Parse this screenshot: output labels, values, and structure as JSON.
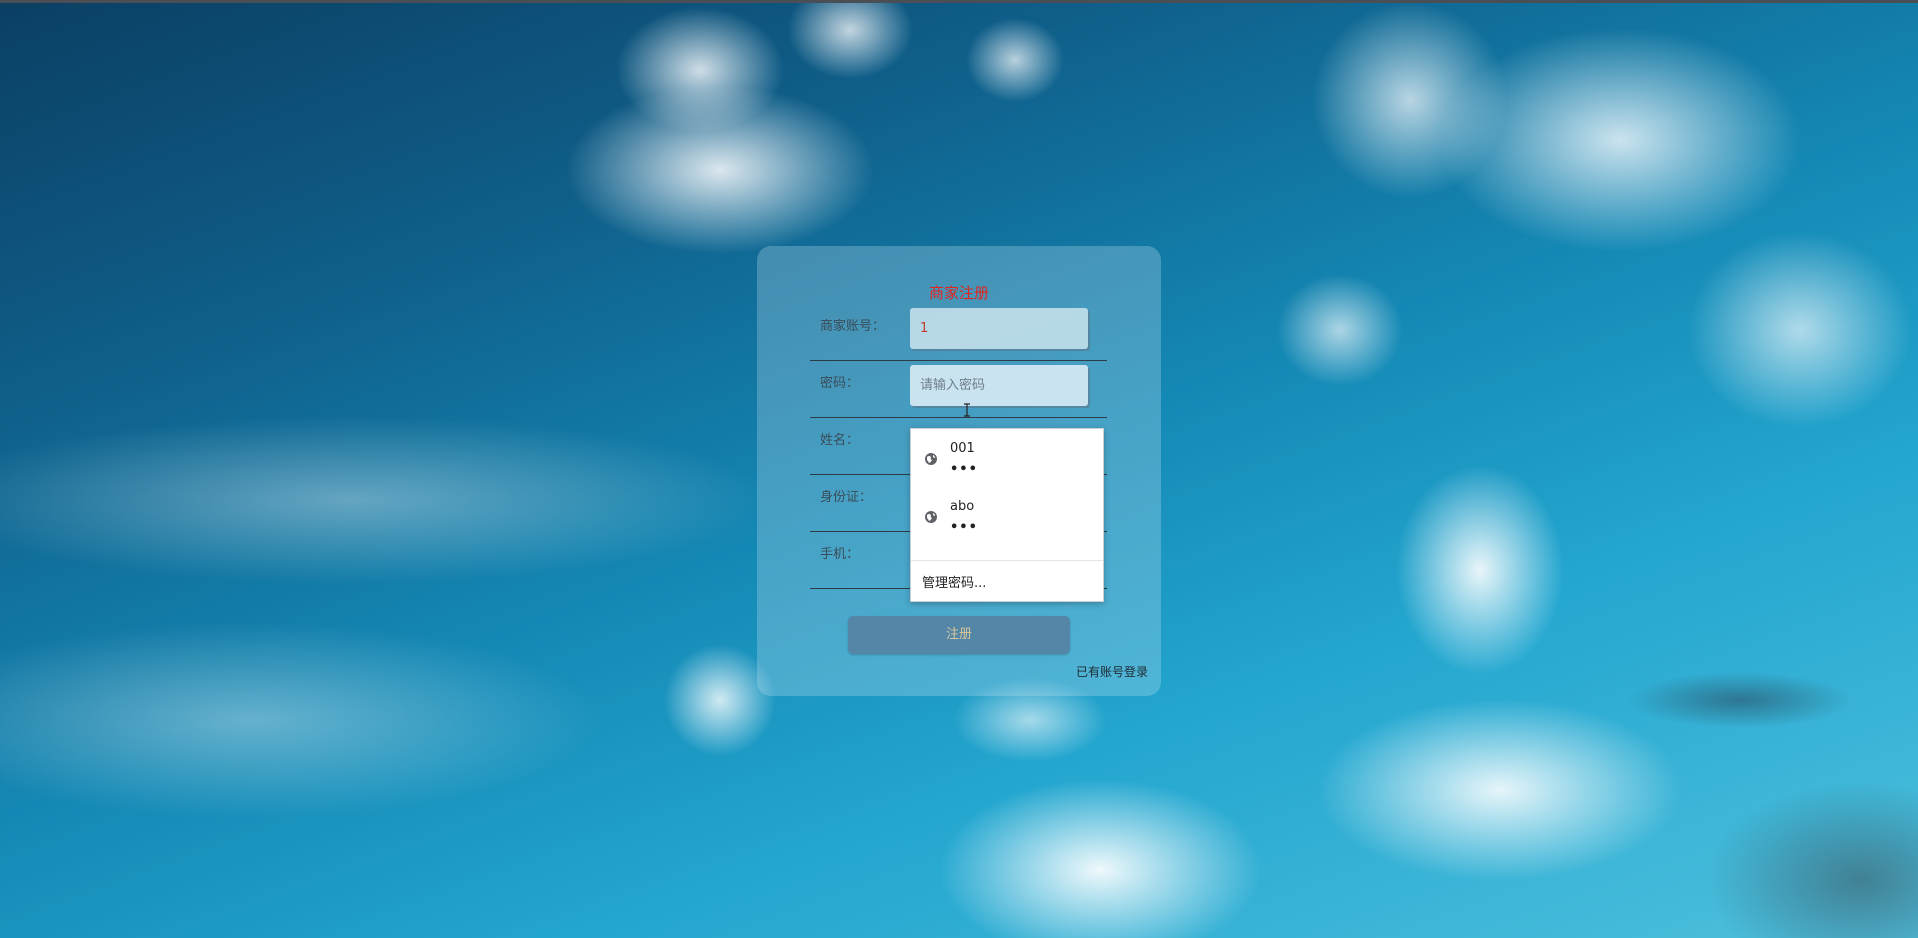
{
  "form": {
    "title": "商家注册",
    "fields": [
      {
        "label": "商家账号：",
        "value": "1",
        "placeholder": ""
      },
      {
        "label": "密码：",
        "value": "",
        "placeholder": "请输入密码"
      },
      {
        "label": "姓名：",
        "value": "",
        "placeholder": ""
      },
      {
        "label": "身份证：",
        "value": "",
        "placeholder": ""
      },
      {
        "label": "手机：",
        "value": "",
        "placeholder": ""
      }
    ],
    "register_button": "注册",
    "login_link": "已有账号登录"
  },
  "autofill": {
    "entries": [
      {
        "username": "001",
        "password_mask": "•••",
        "icon": "globe-icon"
      },
      {
        "username": "abo",
        "password_mask": "•••",
        "icon": "globe-icon"
      }
    ],
    "manage_label": "管理密码..."
  },
  "colors": {
    "title": "#e0251f",
    "button_bg": "#5486a8",
    "button_text": "#d9c799"
  }
}
